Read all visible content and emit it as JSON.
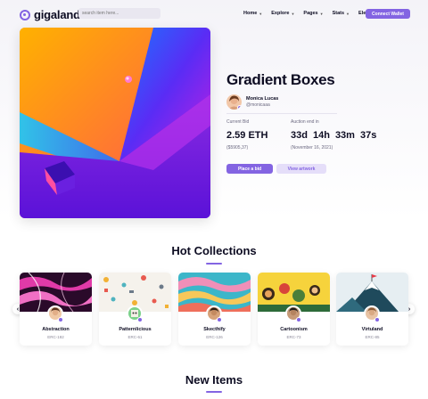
{
  "header": {
    "logo_text": "gigaland",
    "search_placeholder": "search item here...",
    "nav": [
      {
        "label": "Home"
      },
      {
        "label": "Explore"
      },
      {
        "label": "Pages"
      },
      {
        "label": "Stats"
      },
      {
        "label": "Elements"
      }
    ],
    "connect_label": "Connect Wallet"
  },
  "hero": {
    "title": "Gradient Boxes",
    "creator_name": "Monica Lucas",
    "creator_handle": "@monicaaa",
    "bid_label": "Current Bid",
    "bid_value": "2.59 ETH",
    "bid_usd": "($5905,37)",
    "auction_label": "Auction end in",
    "countdown": [
      "33d",
      "14h",
      "33m",
      "37s"
    ],
    "auction_date": "(November 16, 2021)",
    "place_bid_label": "Place a bid",
    "view_artwork_label": "View artwork"
  },
  "hot_collections": {
    "title": "Hot Collections",
    "items": [
      {
        "name": "Abstraction",
        "code": "ERC-192"
      },
      {
        "name": "Patternlicious",
        "code": "ERC-61"
      },
      {
        "name": "Skecthify",
        "code": "ERC-126"
      },
      {
        "name": "Cartoonism",
        "code": "ERC-73"
      },
      {
        "name": "Virtuland",
        "code": "ERC-85"
      }
    ]
  },
  "new_items": {
    "title": "New Items"
  },
  "colors": {
    "accent": "#8364e2",
    "accent_light": "#e5def9",
    "text": "#0d0c22"
  }
}
